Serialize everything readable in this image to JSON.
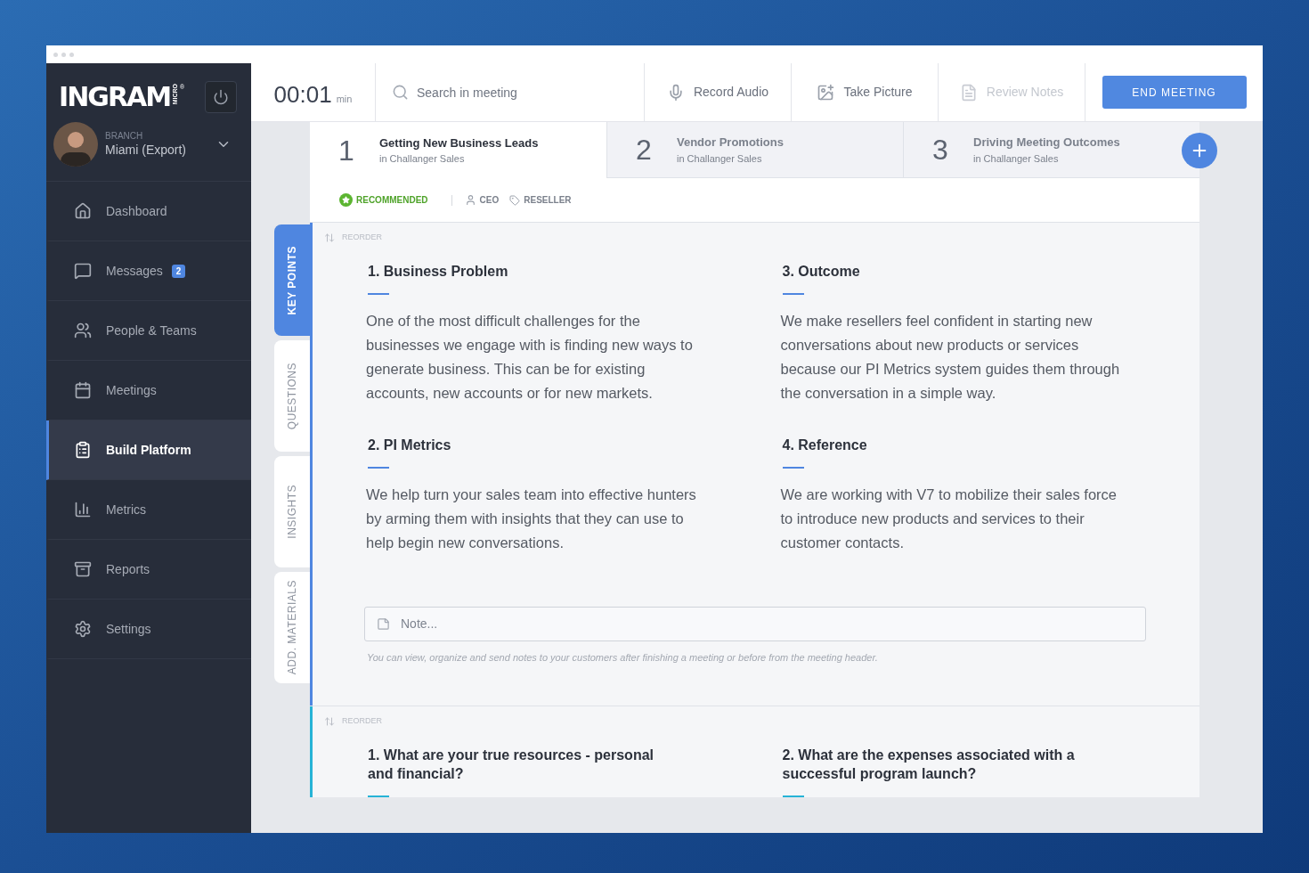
{
  "sidebar": {
    "logo": {
      "name": "INGRAM",
      "sub": "MICRO",
      "mark": "®"
    },
    "branch": {
      "label": "BRANCH",
      "value": "Miami (Export)"
    },
    "items": [
      {
        "label": "Dashboard",
        "selected": false
      },
      {
        "label": "Messages",
        "selected": false,
        "badge": "2"
      },
      {
        "label": "People & Teams",
        "selected": false
      },
      {
        "label": "Meetings",
        "selected": false
      },
      {
        "label": "Build Platform",
        "selected": true
      },
      {
        "label": "Metrics",
        "selected": false
      },
      {
        "label": "Reports",
        "selected": false
      },
      {
        "label": "Settings",
        "selected": false
      }
    ]
  },
  "header": {
    "timer": "00:01",
    "timer_unit": "min",
    "search": {
      "placeholder": "Search in meeting"
    },
    "actions": [
      {
        "label": "Record Audio",
        "disabled": false
      },
      {
        "label": "Take Picture",
        "disabled": false
      },
      {
        "label": "Review Notes",
        "disabled": true
      }
    ],
    "end_button": "END MEETING"
  },
  "topics": [
    {
      "number": "1",
      "title": "Getting New Business Leads",
      "subtitle": "in Challanger Sales",
      "selected": true
    },
    {
      "number": "2",
      "title": "Vendor Promotions",
      "subtitle": "in Challanger Sales",
      "selected": false
    },
    {
      "number": "3",
      "title": "Driving Meeting Outcomes",
      "subtitle": "in Challanger Sales",
      "selected": false
    }
  ],
  "tags": [
    {
      "label": "RECOMMENDED",
      "kind": "recommended"
    },
    {
      "label": "CEO",
      "kind": "role"
    },
    {
      "label": "RESELLER",
      "kind": "tag"
    }
  ],
  "side_tabs": [
    {
      "label": "KEY POINTS",
      "selected": true
    },
    {
      "label": "QUESTIONS",
      "selected": false
    },
    {
      "label": "INSIGHTS",
      "selected": false
    },
    {
      "label": "ADD. MATERIALS",
      "selected": false
    }
  ],
  "sections": [
    {
      "reorder": "REORDER",
      "color": "#4f86e0",
      "items": [
        {
          "title": "1. Business Problem",
          "body": "One of the most difficult challenges for the businesses we engage with is finding new ways to generate business. This can be for existing accounts, new accounts or for new markets."
        },
        {
          "title": "3. Outcome",
          "body": "We make resellers feel confident in starting new conversations about new products or services because our PI Metrics system guides them through the conversation in a simple way."
        },
        {
          "title": "2. PI Metrics",
          "body": "We help turn your sales team into effective hunters by arming them with insights that they can use to help begin new conversations."
        },
        {
          "title": "4. Reference",
          "body": "We are working with V7 to mobilize their sales force to introduce new products and services to their customer contacts."
        }
      ],
      "note": {
        "placeholder": "Note..."
      },
      "hint": "You can view, organize and send notes to your customers after finishing a meeting or before from the meeting header."
    },
    {
      "reorder": "REORDER",
      "color": "#26b3d6",
      "items": [
        {
          "title": "1. What are your true resources - personal and financial?"
        },
        {
          "title": "2. What are the expenses associated with a successful program launch?"
        }
      ]
    }
  ]
}
